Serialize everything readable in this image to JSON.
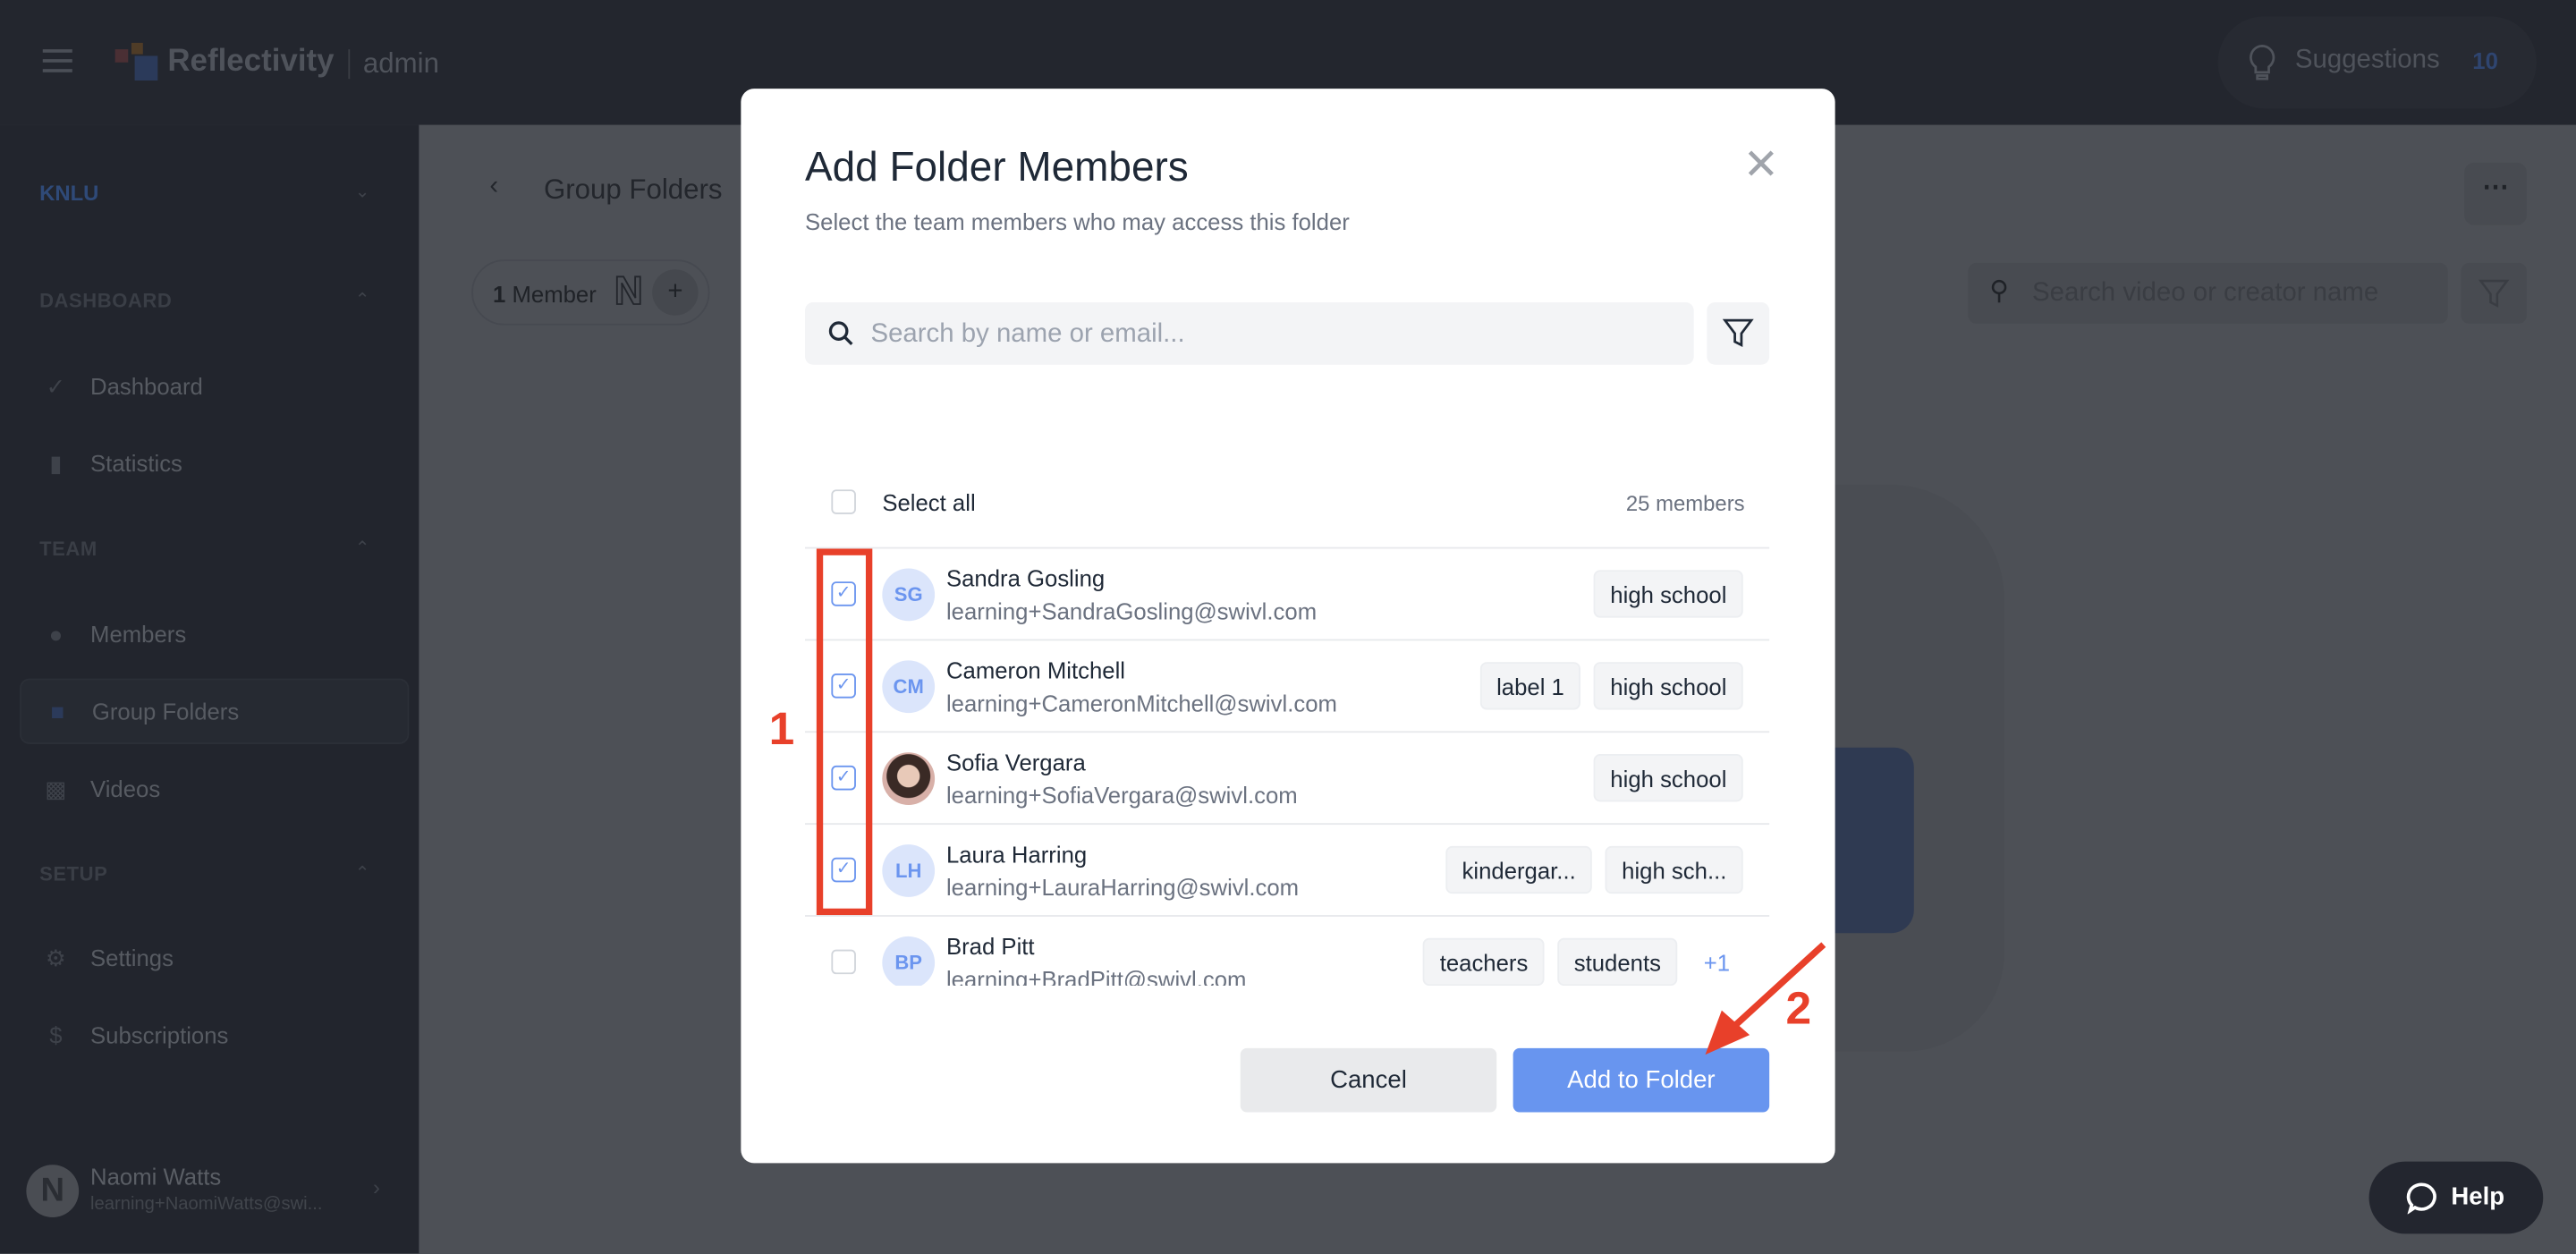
{
  "app": {
    "brand": "Reflectivity",
    "subtitle": "admin"
  },
  "topbar": {
    "suggestions_label": "Suggestions",
    "suggestions_count": "10"
  },
  "sidebar": {
    "org": "KNLU",
    "sections": [
      {
        "title": "DASHBOARD",
        "items": [
          {
            "label": "Dashboard",
            "icon": "chart-line-icon"
          },
          {
            "label": "Statistics",
            "icon": "bar-chart-icon"
          }
        ]
      },
      {
        "title": "TEAM",
        "items": [
          {
            "label": "Members",
            "icon": "user-icon"
          },
          {
            "label": "Group Folders",
            "icon": "folder-icon",
            "active": true
          },
          {
            "label": "Videos",
            "icon": "film-icon"
          }
        ]
      },
      {
        "title": "SETUP",
        "items": [
          {
            "label": "Settings",
            "icon": "gear-icon"
          },
          {
            "label": "Subscriptions",
            "icon": "receipt-icon"
          }
        ]
      }
    ],
    "user": {
      "name": "Naomi Watts",
      "email": "learning+NaomiWatts@swi...",
      "initial": "N"
    }
  },
  "main": {
    "breadcrumb": "Group Folders",
    "members_count_num": "1",
    "members_count_label": "Member",
    "member_avatar_initial": "N",
    "search_placeholder": "Search video or creator name"
  },
  "modal": {
    "title": "Add Folder Members",
    "subtitle": "Select the team members who may access this folder",
    "search_placeholder": "Search by name or email...",
    "select_all_label": "Select all",
    "members_count": "25 members",
    "members": [
      {
        "initials": "SG",
        "name": "Sandra Gosling",
        "email": "learning+SandraGosling@swivl.com",
        "tags": [
          "high school"
        ],
        "checked": true
      },
      {
        "initials": "CM",
        "name": "Cameron Mitchell",
        "email": "learning+CameronMitchell@swivl.com",
        "tags": [
          "label 1",
          "high school"
        ],
        "checked": true
      },
      {
        "initials": "",
        "photo": true,
        "name": "Sofia Vergara",
        "email": "learning+SofiaVergara@swivl.com",
        "tags": [
          "high school"
        ],
        "checked": true
      },
      {
        "initials": "LH",
        "name": "Laura Harring",
        "email": "learning+LauraHarring@swivl.com",
        "tags": [
          "kindergar...",
          "high sch..."
        ],
        "checked": true
      },
      {
        "initials": "BP",
        "name": "Brad Pitt",
        "email": "learning+BradPitt@swivl.com",
        "tags": [
          "teachers",
          "students"
        ],
        "more": "+1",
        "checked": false
      }
    ],
    "cancel_label": "Cancel",
    "confirm_label": "Add to Folder"
  },
  "annotations": {
    "step1": "1",
    "step2": "2",
    "color": "#e8402a"
  },
  "help": {
    "label": "Help"
  },
  "colors": {
    "accent": "#6895ef",
    "sidebar": "#22252d",
    "topbar": "#23262e"
  }
}
